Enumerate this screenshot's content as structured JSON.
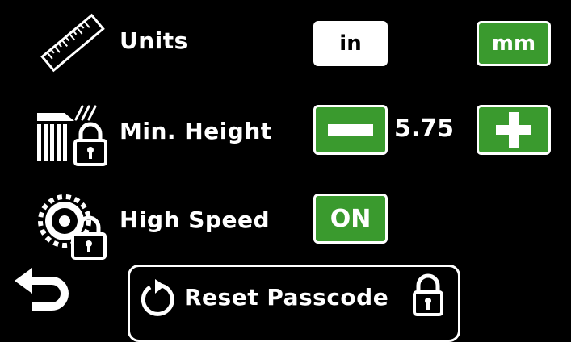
{
  "settings": {
    "units": {
      "label": "Units",
      "options": [
        "in",
        "mm"
      ],
      "selected": "mm",
      "icon": "ruler-icon"
    },
    "min_height": {
      "label": "Min. Height",
      "value": "5.75",
      "icon": "grass-height-lock-icon",
      "locked": true
    },
    "high_speed": {
      "label": "High Speed",
      "state": "ON",
      "icon": "gear-lock-icon",
      "locked": true
    }
  },
  "footer": {
    "back_icon": "back-arrow-icon",
    "reset_label": "Reset Passcode",
    "reset_icon": "reset-icon",
    "lock_icon": "padlock-icon"
  },
  "colors": {
    "background": "#000000",
    "accent_green": "#3a9a2e",
    "text": "#ffffff"
  }
}
